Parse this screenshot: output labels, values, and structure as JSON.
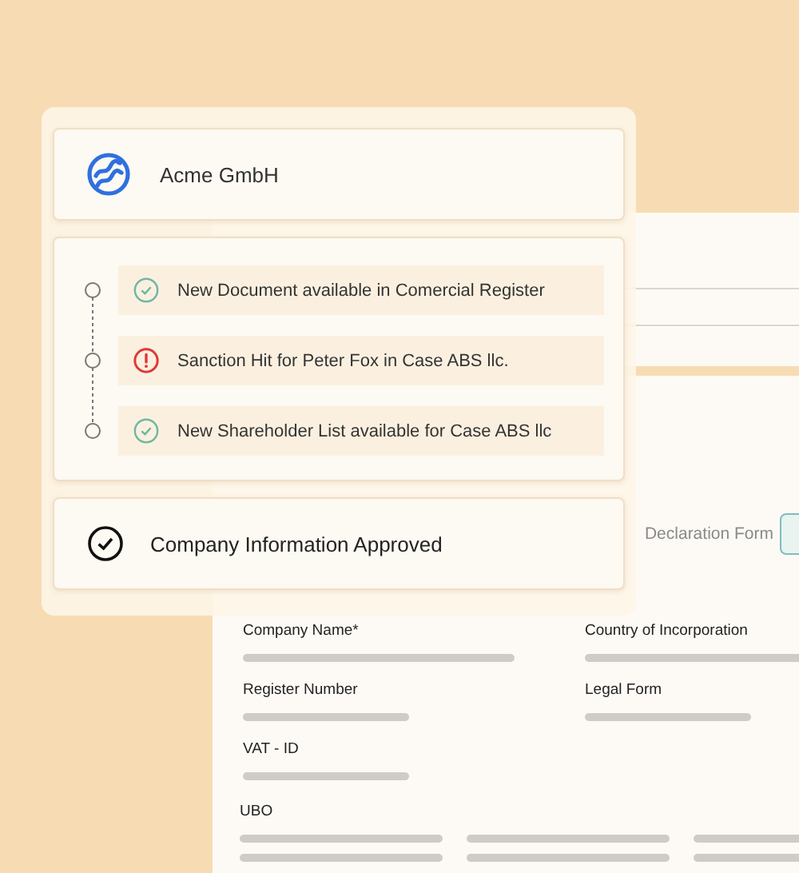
{
  "company": {
    "name": "Acme GmbH"
  },
  "events": [
    {
      "kind": "success",
      "text": "New Document available in Comercial Register"
    },
    {
      "kind": "alert",
      "text": "Sanction Hit for Peter Fox in Case ABS llc."
    },
    {
      "kind": "success",
      "text": "New Shareholder List available for Case ABS llc"
    }
  ],
  "status": {
    "text": "Company Information Approved"
  },
  "form": {
    "section": "Declaration Form",
    "fields": [
      {
        "label": "Company Name*",
        "kind": "long"
      },
      {
        "label": "Country of Incorporation",
        "kind": "wide"
      },
      {
        "label": "Register Number",
        "kind": "short"
      },
      {
        "label": "Legal Form",
        "kind": "short"
      },
      {
        "label": "VAT - ID",
        "kind": "short"
      }
    ],
    "ubo": {
      "label": "UBO"
    }
  }
}
